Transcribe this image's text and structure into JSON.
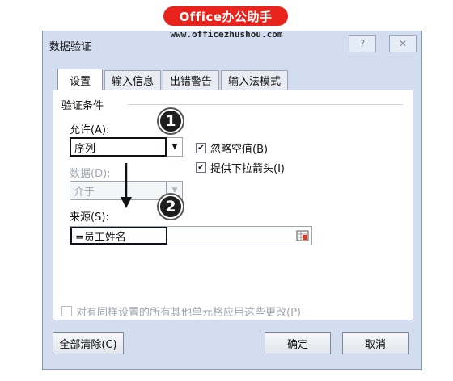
{
  "watermark": {
    "brand": "Office办公助手",
    "site": "www.officezhushou.com"
  },
  "dialog": {
    "title": "数据验证",
    "help_icon": "?",
    "close_icon": "✕",
    "tabs": [
      {
        "label": "设置",
        "active": true
      },
      {
        "label": "输入信息",
        "active": false
      },
      {
        "label": "出错警告",
        "active": false
      },
      {
        "label": "输入法模式",
        "active": false
      }
    ],
    "group_title": "验证条件",
    "allow": {
      "label": "允许(A):",
      "value": "序列"
    },
    "data": {
      "label": "数据(D):",
      "value": "介于"
    },
    "ignore_blank": {
      "label": "忽略空值(B)",
      "checked": true
    },
    "in_cell_dropdown": {
      "label": "提供下拉箭头(I)",
      "checked": true
    },
    "source": {
      "label": "来源(S):",
      "value": "=员工姓名"
    },
    "apply_all": {
      "label": "对有同样设置的所有其他单元格应用这些更改(P)",
      "checked": false
    },
    "buttons": {
      "clear_all": "全部清除(C)",
      "ok": "确定",
      "cancel": "取消"
    },
    "markers": [
      "1",
      "2"
    ],
    "colors": {
      "banner": "#e8231b",
      "dialog_bg": "#d2deef",
      "marker": "#1e1e1e"
    }
  }
}
